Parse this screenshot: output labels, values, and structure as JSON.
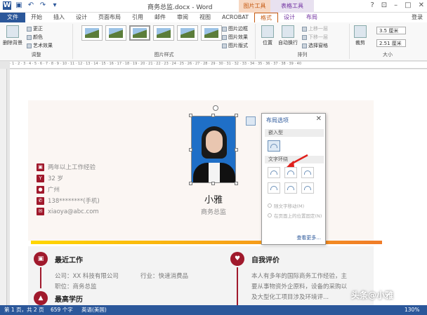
{
  "window": {
    "title": "商务总监.docx - Word",
    "ctx_picture": "图片工具",
    "ctx_table": "表格工具"
  },
  "tabs": [
    "文件",
    "开始",
    "插入",
    "设计",
    "页面布局",
    "引用",
    "邮件",
    "审阅",
    "视图",
    "ACROBAT",
    "格式",
    "设计",
    "布局"
  ],
  "login": "登录",
  "ribbon": {
    "remove_bg": "删除背景",
    "adjust": {
      "corrections": "更正",
      "color": "颜色",
      "artistic": "艺术效果",
      "label": "调整"
    },
    "styles_label": "图片样式",
    "border": "图片边框",
    "effects": "图片效果",
    "layout": "图片版式",
    "arrange": {
      "position": "位置",
      "wrap": "自动换行",
      "forward": "上移一层",
      "backward": "下移一层",
      "selection": "选择窗格",
      "label": "排列"
    },
    "size": {
      "crop": "裁剪",
      "height": "3.5 厘米",
      "width": "2.51 厘米",
      "label": "大小"
    }
  },
  "resume": {
    "name": "小雅",
    "role": "商务总监",
    "info": [
      "两年以上工作经验",
      "32 岁",
      "广州",
      "138********(手机)",
      "xiaoya@abc.com"
    ],
    "recent_work": "最近工作",
    "company_label": "公司：XX 科技有限公司",
    "industry_label": "行业：快速消费品",
    "position_label": "职位：商务总监",
    "self_eval": "自我评价",
    "self_eval_text": [
      "本人有多年的国际商务工作经验，主",
      "要从事物资外企原料，设备的采购以",
      "及大型化工项目涉及环境评..."
    ],
    "edu": "最高学历"
  },
  "layout_panel": {
    "title": "布局选项",
    "inline_label": "嵌入型",
    "wrap_label": "文字环绕",
    "opt1": "随文字移动(M)",
    "opt2": "在页面上的位置固定(N)",
    "more": "查看更多..."
  },
  "status": {
    "page": "第 1 页，共 2 页",
    "words": "659 个字",
    "lang": "英语(美国)",
    "zoom": "130%"
  },
  "watermark": "头条@小雅"
}
